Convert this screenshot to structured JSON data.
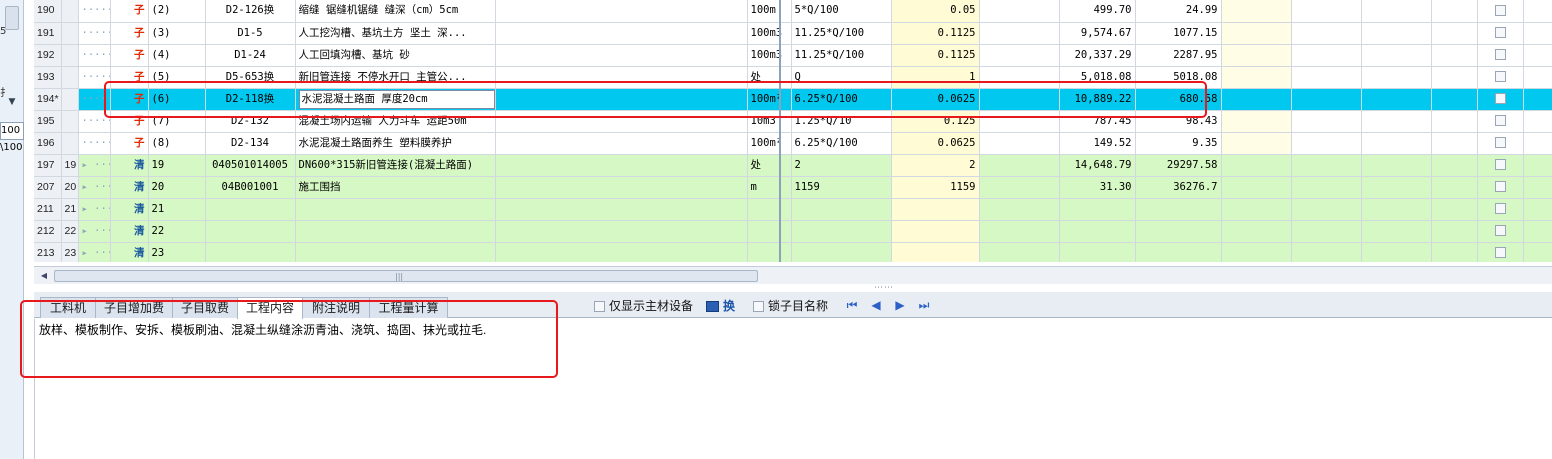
{
  "left_strip": {
    "frag1": "5",
    "frag2": "扌",
    "frag3": "100",
    "frag4": "\\100"
  },
  "grid": {
    "rows": [
      {
        "rownum": "190",
        "serial": "",
        "type": "子",
        "seq": "(2)",
        "code": "D2-126换",
        "name": "缩缝 锯缝机锯缝 缝深（cm）5cm",
        "unit": "100m",
        "expr": "5*Q/100",
        "qty": "0.05",
        "price": "499.70",
        "total": "24.99",
        "style": "child"
      },
      {
        "rownum": "191",
        "serial": "",
        "type": "子",
        "seq": "(3)",
        "code": "D1-5",
        "name": "人工挖沟槽、基坑土方 坚土 深...",
        "unit": "100m3",
        "expr": "11.25*Q/100",
        "qty": "0.1125",
        "price": "9,574.67",
        "total": "1077.15",
        "style": "child"
      },
      {
        "rownum": "192",
        "serial": "",
        "type": "子",
        "seq": "(4)",
        "code": "D1-24",
        "name": "人工回填沟槽、基坑 砂",
        "unit": "100m3",
        "expr": "11.25*Q/100",
        "qty": "0.1125",
        "price": "20,337.29",
        "total": "2287.95",
        "style": "child"
      },
      {
        "rownum": "193",
        "serial": "",
        "type": "子",
        "seq": "(5)",
        "code": "D5-653换",
        "name": "新旧管连接 不停水开口 主管公...",
        "unit": "处",
        "expr": "Q",
        "qty": "1",
        "price": "5,018.08",
        "total": "5018.08",
        "style": "child"
      },
      {
        "rownum": "194*",
        "serial": "",
        "type": "子",
        "seq": "(6)",
        "code": "D2-118换",
        "name": "水泥混凝土路面 厚度20cm",
        "unit": "100m²",
        "expr": "6.25*Q/100",
        "qty": "0.0625",
        "price": "10,889.22",
        "total": "680.58",
        "style": "sel"
      },
      {
        "rownum": "195",
        "serial": "",
        "type": "子",
        "seq": "(7)",
        "code": "D2-132",
        "name": "混凝土场内运输 人力斗车 运距50m",
        "unit": "10m3",
        "expr": "1.25*Q/10",
        "qty": "0.125",
        "price": "787.45",
        "total": "98.43",
        "style": "child"
      },
      {
        "rownum": "196",
        "serial": "",
        "type": "子",
        "seq": "(8)",
        "code": "D2-134",
        "name": "水泥混凝土路面养生 塑料膜养护",
        "unit": "100m²",
        "expr": "6.25*Q/100",
        "qty": "0.0625",
        "price": "149.52",
        "total": "9.35",
        "style": "child"
      },
      {
        "rownum": "197",
        "serial": "19",
        "type": "清",
        "seq": "19",
        "code": "040501014005",
        "name": "DN600*315新旧管连接(混凝土路面)",
        "unit": "处",
        "expr": "2",
        "qty": "2",
        "price": "14,648.79",
        "total": "29297.58",
        "style": "green"
      },
      {
        "rownum": "207",
        "serial": "20",
        "type": "清",
        "seq": "20",
        "code": "04B001001",
        "name": "施工围挡",
        "unit": "m",
        "expr": "1159",
        "qty": "1159",
        "price": "31.30",
        "total": "36276.7",
        "style": "green"
      },
      {
        "rownum": "211",
        "serial": "21",
        "type": "清",
        "seq": "21",
        "code": "",
        "name": "",
        "unit": "",
        "expr": "",
        "qty": "",
        "price": "",
        "total": "",
        "style": "green"
      },
      {
        "rownum": "212",
        "serial": "22",
        "type": "清",
        "seq": "22",
        "code": "",
        "name": "",
        "unit": "",
        "expr": "",
        "qty": "",
        "price": "",
        "total": "",
        "style": "green"
      },
      {
        "rownum": "213",
        "serial": "23",
        "type": "清",
        "seq": "23",
        "code": "",
        "name": "",
        "unit": "",
        "expr": "",
        "qty": "",
        "price": "",
        "total": "",
        "style": "green"
      }
    ]
  },
  "scrollbar": {
    "grip": "|||",
    "split": "⋯⋯"
  },
  "bottom": {
    "tabs": [
      "工料机",
      "子目增加费",
      "子目取费",
      "工程内容",
      "附注说明",
      "工程量计算"
    ],
    "active_tab": 3,
    "main_material_only": "仅显示主材设备",
    "swap_label": "换",
    "lock_sub_name": "锁子目名称",
    "nav_first": "⏮",
    "nav_prev": "◀",
    "nav_next": "▶",
    "nav_last": "⏭",
    "content_text": "放样、模板制作、安拆、模板刷油、混凝土纵缝涂沥青油、浇筑、捣固、抹光或拉毛."
  },
  "colors": {
    "annotation": "#e8191c",
    "selected_row": "#00c8ee",
    "list_row": "#d6f8c4"
  }
}
